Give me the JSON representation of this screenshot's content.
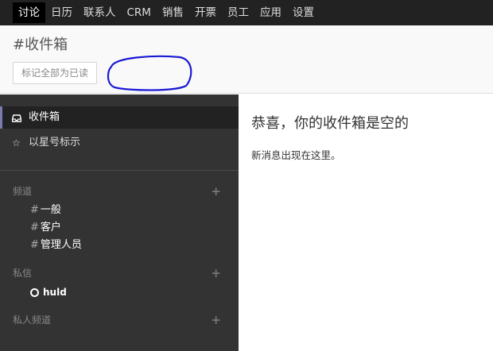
{
  "topnav": {
    "items": [
      {
        "label": "讨论",
        "active": true
      },
      {
        "label": "日历"
      },
      {
        "label": "联系人"
      },
      {
        "label": "CRM"
      },
      {
        "label": "销售"
      },
      {
        "label": "开票"
      },
      {
        "label": "员工"
      },
      {
        "label": "应用"
      },
      {
        "label": "设置"
      }
    ]
  },
  "control": {
    "title": "#收件箱",
    "mark_all_label": "标记全部为已读"
  },
  "sidebar": {
    "boxes": [
      {
        "label": "收件箱",
        "icon": "inbox-icon"
      },
      {
        "label": "以星号标示",
        "icon": "star-icon"
      }
    ],
    "channels_header": "频道",
    "channels": [
      "一般",
      "客户",
      "管理人员"
    ],
    "dm_header": "私信",
    "dms": [
      {
        "name": "huld",
        "status": "offline"
      }
    ],
    "private_header": "私人频道",
    "hash": "#",
    "add": "+"
  },
  "main": {
    "empty_title": "恭喜，你的收件箱是空的",
    "empty_text": "新消息出现在这里。"
  },
  "colors": {
    "topnav_bg": "#222222",
    "sidebar_bg": "#333333",
    "active_accent": "#7c7bad",
    "annotation": "#1a1ad6"
  }
}
